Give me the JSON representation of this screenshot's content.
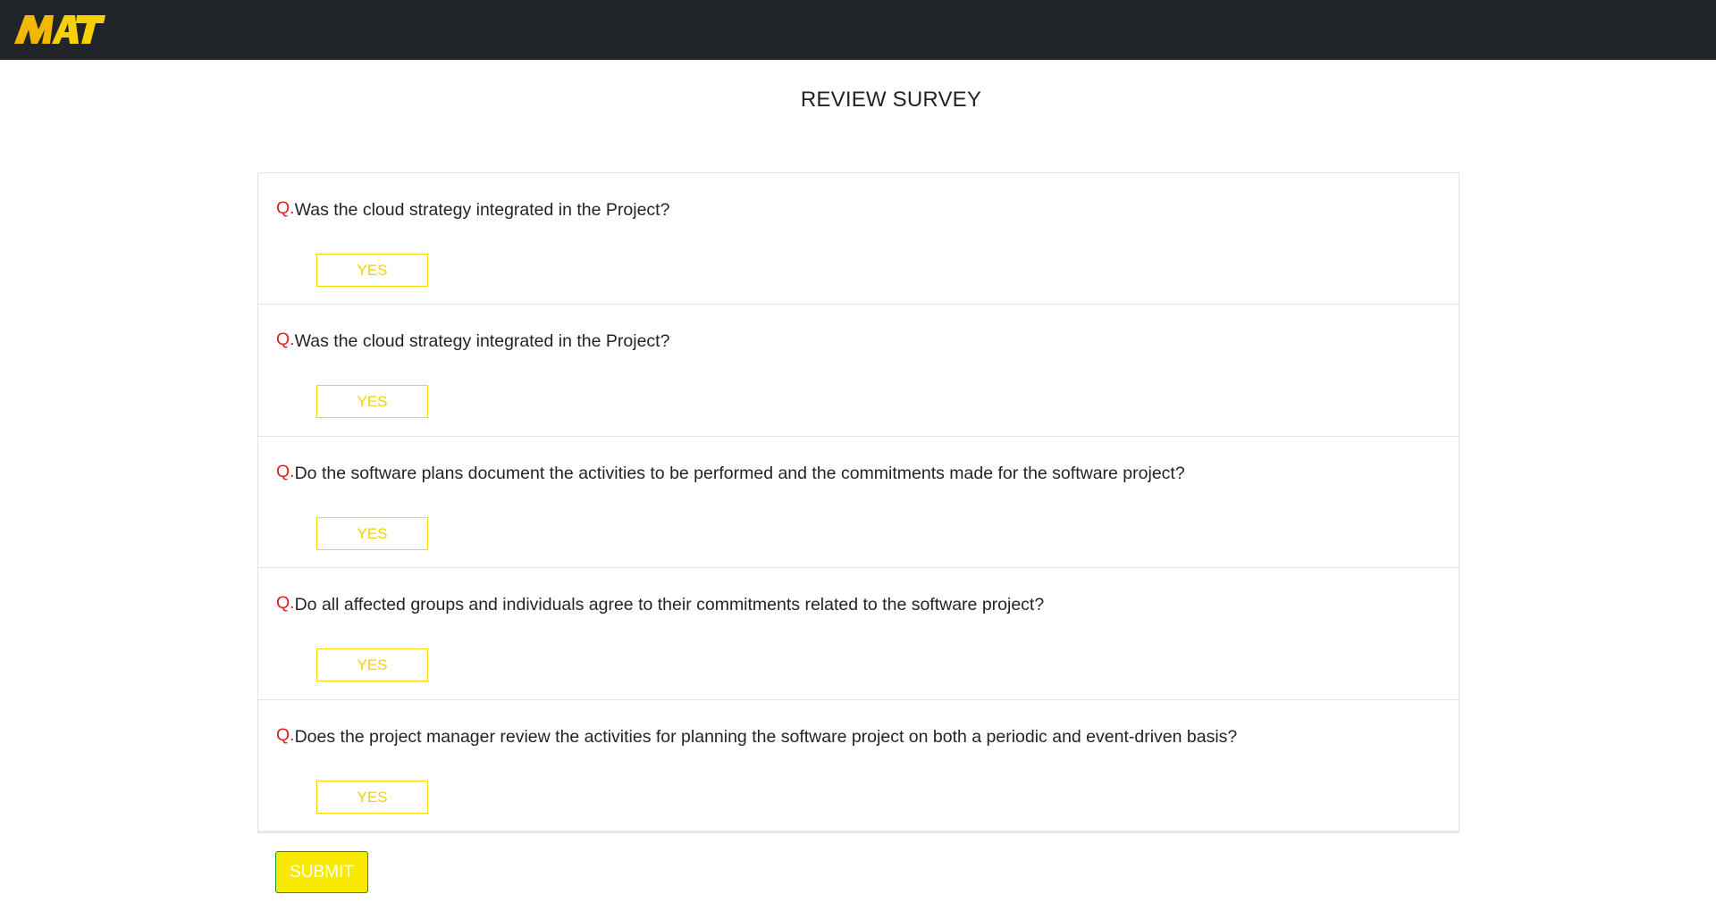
{
  "header": {
    "logo_text": "MAT",
    "logo_icon": "mat-logo"
  },
  "page": {
    "title": "REVIEW SURVEY"
  },
  "survey": {
    "question_prefix": "Q.",
    "questions": [
      {
        "text": "Was the cloud strategy integrated in the Project?",
        "answer_label": "YES"
      },
      {
        "text": "Was the cloud strategy integrated in the Project?",
        "answer_label": "YES"
      },
      {
        "text": "Do the software plans document the activities to be performed and the commitments made for the software project?",
        "answer_label": "YES"
      },
      {
        "text": "Do all affected groups and individuals agree to their commitments related to the software project?",
        "answer_label": "YES"
      },
      {
        "text": "Does the project manager review the activities for planning the software project on both a periodic and event-driven basis?",
        "answer_label": "YES"
      }
    ]
  },
  "actions": {
    "submit_label": "SUBMIT"
  },
  "colors": {
    "topbar": "#212529",
    "brand_yellow": "#f9e800",
    "question_prefix": "#e0221b",
    "submit_border": "#1f8f3a"
  }
}
